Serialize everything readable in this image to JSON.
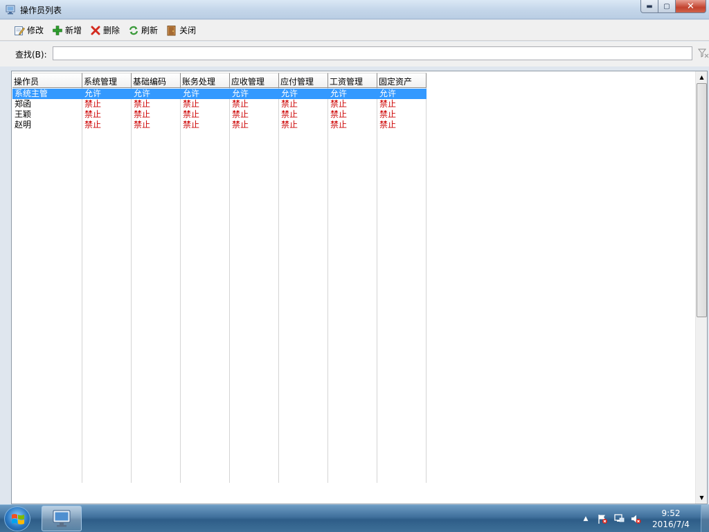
{
  "window": {
    "title": "操作员列表",
    "min_label": "▬",
    "max_label": "▢",
    "close_label": "✕"
  },
  "toolbar": {
    "edit_label": "修改",
    "add_label": "新增",
    "delete_label": "删除",
    "refresh_label": "刷新",
    "close_label": "关闭"
  },
  "search": {
    "label": "查找(B):",
    "value": "",
    "placeholder": ""
  },
  "grid": {
    "columns": [
      "操作员",
      "系统管理",
      "基础编码",
      "账务处理",
      "应收管理",
      "应付管理",
      "工资管理",
      "固定资产"
    ],
    "rows": [
      {
        "name": "系统主管",
        "perms": [
          "允许",
          "允许",
          "允许",
          "允许",
          "允许",
          "允许",
          "允许"
        ],
        "selected": true
      },
      {
        "name": "郑函",
        "perms": [
          "禁止",
          "禁止",
          "禁止",
          "禁止",
          "禁止",
          "禁止",
          "禁止"
        ],
        "selected": false
      },
      {
        "name": "王颖",
        "perms": [
          "禁止",
          "禁止",
          "禁止",
          "禁止",
          "禁止",
          "禁止",
          "禁止"
        ],
        "selected": false
      },
      {
        "name": "赵明",
        "perms": [
          "禁止",
          "禁止",
          "禁止",
          "禁止",
          "禁止",
          "禁止",
          "禁止"
        ],
        "selected": false
      }
    ]
  },
  "taskbar": {
    "time": "9:52",
    "date": "2016/7/4",
    "tray_arrow": "▲"
  },
  "colors": {
    "selection": "#3399ff",
    "deny_text": "#cc0000"
  }
}
